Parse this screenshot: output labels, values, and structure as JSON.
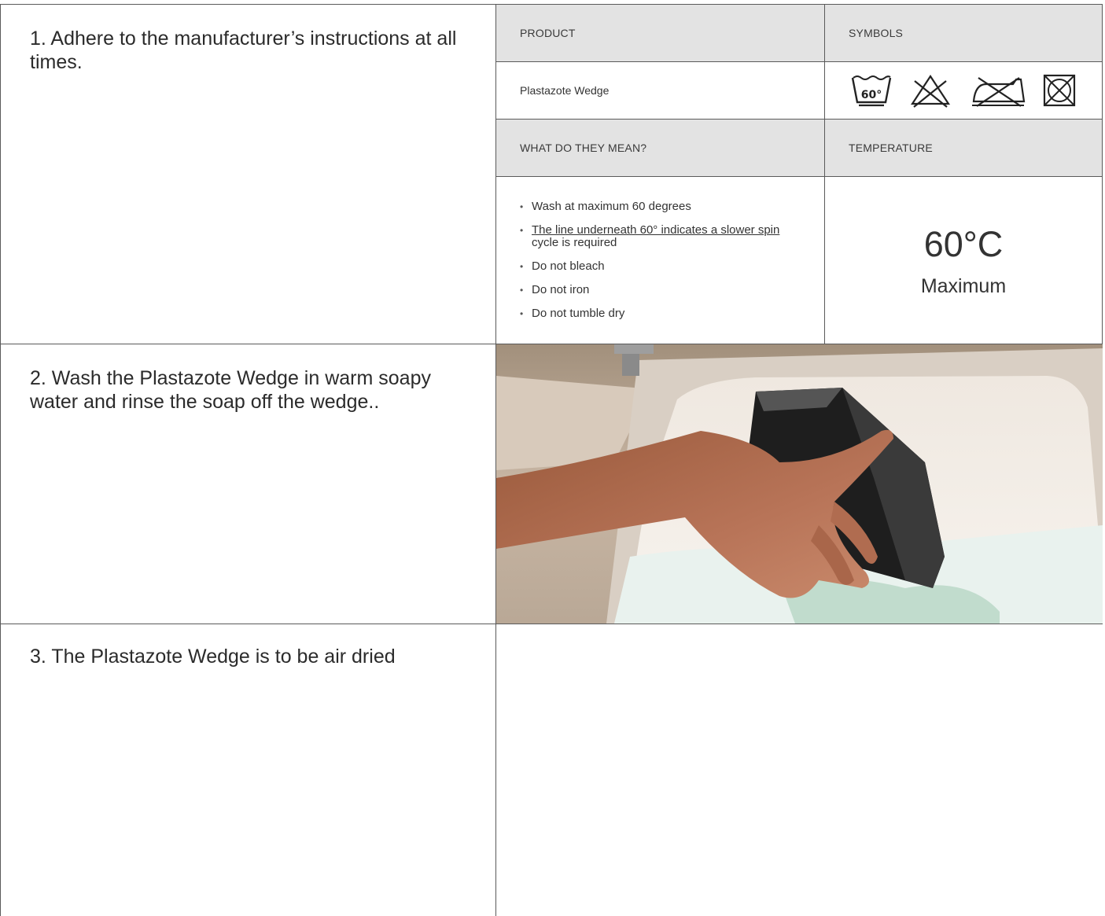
{
  "steps": [
    "1. Adhere to the manufacturer’s instructions at all times.",
    "2. Wash the Plastazote Wedge in warm soapy water and rinse the soap off the wedge..",
    "3. The Plastazote Wedge is to be air dried"
  ],
  "care_table": {
    "header_product": "PRODUCT",
    "header_symbols": "SYMBOLS",
    "product_name": "Plastazote Wedge",
    "symbols": [
      "wash-60-gentle-icon",
      "do-not-bleach-icon",
      "do-not-iron-icon",
      "do-not-tumble-dry-icon"
    ],
    "wash_symbol_label": "60°",
    "header_meaning": "WHAT DO THEY MEAN?",
    "header_temperature": "TEMPERATURE",
    "meanings": [
      "Wash at maximum 60 degrees",
      "The line underneath 60° indicates a slower spin",
      "Do not bleach",
      "Do not iron",
      "Do not tumble dry"
    ],
    "meaning_2_suffix": " cycle is required",
    "temperature_value": "60°C",
    "temperature_label": "Maximum"
  },
  "photo_alt": "hand-washing-wedge-photo"
}
